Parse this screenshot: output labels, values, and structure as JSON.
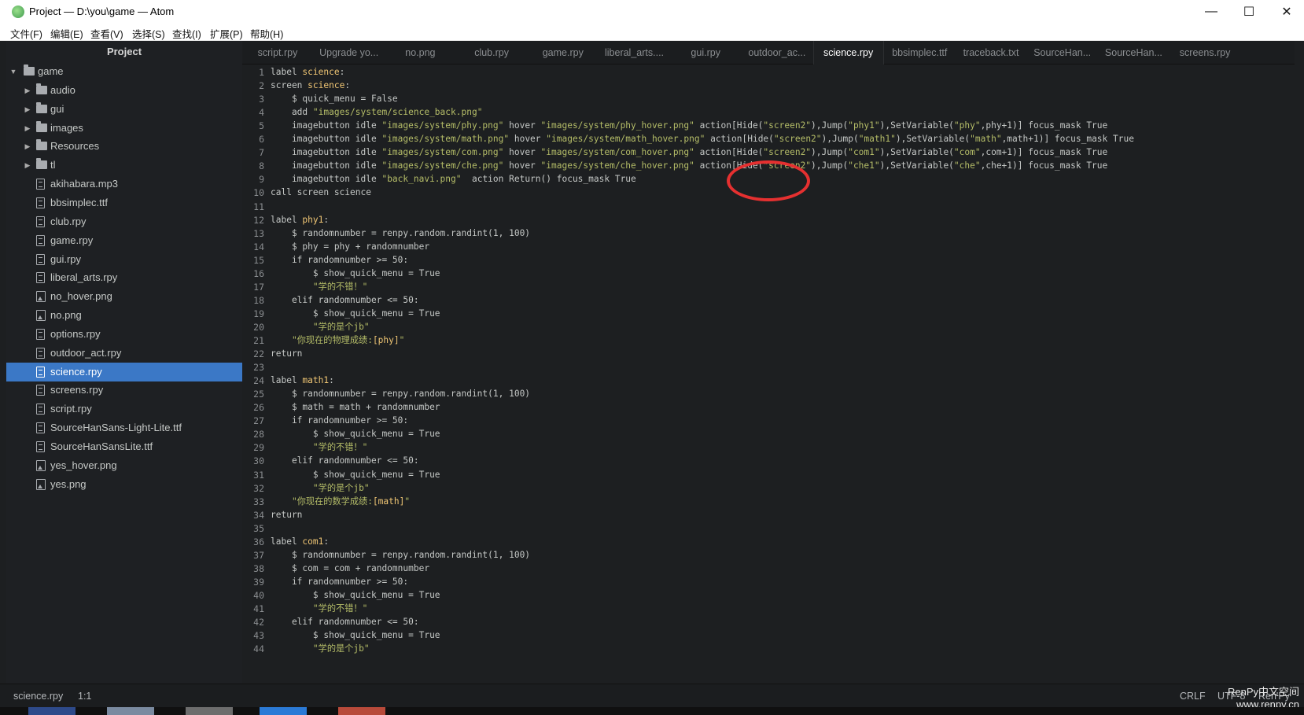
{
  "window": {
    "title": "Project — D:\\you\\game — Atom",
    "minimize": "—",
    "maximize": "☐",
    "close": "✕"
  },
  "menu": {
    "items": [
      "文件(F)",
      "编辑(E)",
      "查看(V)",
      "选择(S)",
      "查找(I)",
      "扩展(P)",
      "帮助(H)"
    ]
  },
  "sidebar": {
    "header": "Project",
    "root": "game",
    "items": [
      {
        "type": "folder",
        "label": "audio"
      },
      {
        "type": "folder",
        "label": "gui"
      },
      {
        "type": "folder",
        "label": "images"
      },
      {
        "type": "folder",
        "label": "Resources"
      },
      {
        "type": "folder",
        "label": "tl"
      },
      {
        "type": "file",
        "label": "akihabara.mp3"
      },
      {
        "type": "file",
        "label": "bbsimplec.ttf"
      },
      {
        "type": "file",
        "label": "club.rpy"
      },
      {
        "type": "file",
        "label": "game.rpy"
      },
      {
        "type": "file",
        "label": "gui.rpy"
      },
      {
        "type": "file",
        "label": "liberal_arts.rpy"
      },
      {
        "type": "image",
        "label": "no_hover.png"
      },
      {
        "type": "image",
        "label": "no.png"
      },
      {
        "type": "file",
        "label": "options.rpy"
      },
      {
        "type": "file",
        "label": "outdoor_act.rpy"
      },
      {
        "type": "file",
        "label": "science.rpy",
        "selected": true
      },
      {
        "type": "file",
        "label": "screens.rpy"
      },
      {
        "type": "file",
        "label": "script.rpy"
      },
      {
        "type": "file",
        "label": "SourceHanSans-Light-Lite.ttf"
      },
      {
        "type": "file",
        "label": "SourceHanSansLite.ttf"
      },
      {
        "type": "image",
        "label": "yes_hover.png"
      },
      {
        "type": "image",
        "label": "yes.png"
      }
    ]
  },
  "tabs": [
    {
      "label": "script.rpy"
    },
    {
      "label": "Upgrade yo..."
    },
    {
      "label": "no.png"
    },
    {
      "label": "club.rpy"
    },
    {
      "label": "game.rpy"
    },
    {
      "label": "liberal_arts...."
    },
    {
      "label": "gui.rpy"
    },
    {
      "label": "outdoor_ac..."
    },
    {
      "label": "science.rpy",
      "active": true
    },
    {
      "label": "bbsimplec.ttf"
    },
    {
      "label": "traceback.txt"
    },
    {
      "label": "SourceHan..."
    },
    {
      "label": "SourceHan..."
    },
    {
      "label": "screens.rpy"
    }
  ],
  "editor": {
    "lines": [
      "label science:",
      "screen science:",
      "    $ quick_menu = False",
      "    add \"images/system/science_back.png\"",
      "    imagebutton idle \"images/system/phy.png\" hover \"images/system/phy_hover.png\" action[Hide(\"screen2\"),Jump(\"phy1\"),SetVariable(\"phy\",phy+1)] focus_mask True",
      "    imagebutton idle \"images/system/math.png\" hover \"images/system/math_hover.png\" action[Hide(\"screen2\"),Jump(\"math1\"),SetVariable(\"math\",math+1)] focus_mask True",
      "    imagebutton idle \"images/system/com.png\" hover \"images/system/com_hover.png\" action[Hide(\"screen2\"),Jump(\"com1\"),SetVariable(\"com\",com+1)] focus_mask True",
      "    imagebutton idle \"images/system/che.png\" hover \"images/system/che_hover.png\" action[Hide(\"screen2\"),Jump(\"che1\"),SetVariable(\"che\",che+1)] focus_mask True",
      "    imagebutton idle \"back_navi.png\"  action Return() focus_mask True",
      "call screen science",
      "",
      "label phy1:",
      "    $ randomnumber = renpy.random.randint(1, 100)",
      "    $ phy = phy + randomnumber",
      "    if randomnumber >= 50:",
      "        $ show_quick_menu = True",
      "        \"学的不错！\"",
      "    elif randomnumber <= 50:",
      "        $ show_quick_menu = True",
      "        \"学的是个jb\"",
      "    \"你现在的物理成绩:[phy]\"",
      "return",
      "",
      "label math1:",
      "    $ randomnumber = renpy.random.randint(1, 100)",
      "    $ math = math + randomnumber",
      "    if randomnumber >= 50:",
      "        $ show_quick_menu = True",
      "        \"学的不错！\"",
      "    elif randomnumber <= 50:",
      "        $ show_quick_menu = True",
      "        \"学的是个jb\"",
      "    \"你现在的数学成绩:[math]\"",
      "return",
      "",
      "label com1:",
      "    $ randomnumber = renpy.random.randint(1, 100)",
      "    $ com = com + randomnumber",
      "    if randomnumber >= 50:",
      "        $ show_quick_menu = True",
      "        \"学的不错！\"",
      "    elif randomnumber <= 50:",
      "        $ show_quick_menu = True",
      "        \"学的是个jb\""
    ]
  },
  "status": {
    "file": "science.rpy",
    "cursor": "1:1",
    "line_ending": "CRLF",
    "encoding": "UTF-8",
    "grammar": "Ren'Py"
  },
  "watermark": {
    "line1": "RenPy中文空间",
    "line2": "www.renpy.cn"
  },
  "colors": {
    "accent": "#3b78c6",
    "annotation_circle": "#e53030"
  }
}
